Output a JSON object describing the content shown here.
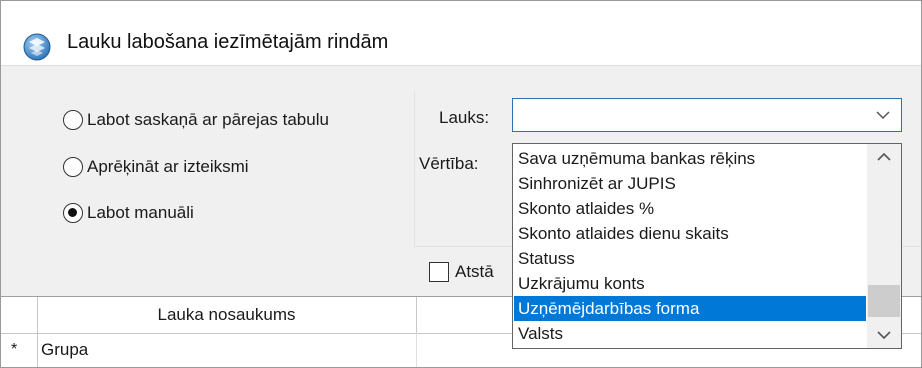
{
  "window": {
    "title": "Lauku labošana iezīmētajām rindām",
    "icon": "app-globe-icon"
  },
  "mode_options": [
    {
      "label": "Labot saskaņā ar pārejas tabulu",
      "checked": false
    },
    {
      "label": "Aprēķināt ar izteiksmi",
      "checked": false
    },
    {
      "label": "Labot manuāli",
      "checked": true
    }
  ],
  "field_panel": {
    "field_label": "Lauks:",
    "field_value": "",
    "value_label": "Vērtība:",
    "dropdown_items": [
      {
        "label": "Sava uzņēmuma bankas rēķins",
        "selected": false
      },
      {
        "label": "Sinhronizēt ar JUPIS",
        "selected": false
      },
      {
        "label": "Skonto atlaides %",
        "selected": false
      },
      {
        "label": "Skonto atlaides dienu skaits",
        "selected": false
      },
      {
        "label": "Statuss",
        "selected": false
      },
      {
        "label": "Uzkrājumu konts",
        "selected": false
      },
      {
        "label": "Uzņēmējdarbības forma",
        "selected": true
      },
      {
        "label": "Valsts",
        "selected": false
      }
    ]
  },
  "keep_checkbox": {
    "label_visible": "Atstā",
    "checked": false
  },
  "grid": {
    "columns": [
      "Lauka nosaukums",
      ""
    ],
    "rows": [
      {
        "marker": "*",
        "cells": [
          "Grupa",
          ""
        ]
      }
    ]
  },
  "colors": {
    "selection": "#0078d7",
    "combo_border": "#2d6fb8",
    "background": "#f0f0f0"
  }
}
